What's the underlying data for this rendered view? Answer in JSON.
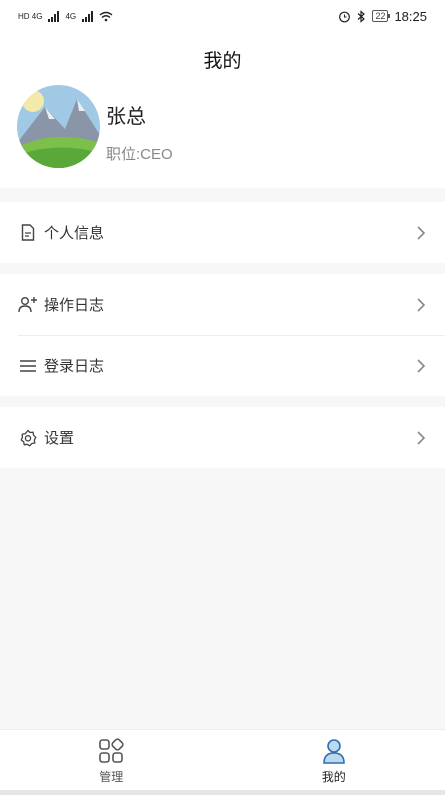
{
  "status_bar": {
    "network_left": "HD 4G",
    "network_right": "4G",
    "battery": "22",
    "time": "18:25"
  },
  "header": {
    "title": "我的"
  },
  "profile": {
    "name": "张总",
    "position": "职位:CEO"
  },
  "menu": {
    "personal_info": "个人信息",
    "operation_log": "操作日志",
    "login_log": "登录日志",
    "settings": "设置"
  },
  "tabbar": {
    "manage": "管理",
    "mine": "我的",
    "active_color": "#4a90e2"
  },
  "icons": {
    "personal_info": "document-icon",
    "operation_log": "user-add-icon",
    "login_log": "list-icon",
    "settings": "gear-icon",
    "manage": "grid-icon",
    "mine": "user-icon"
  }
}
